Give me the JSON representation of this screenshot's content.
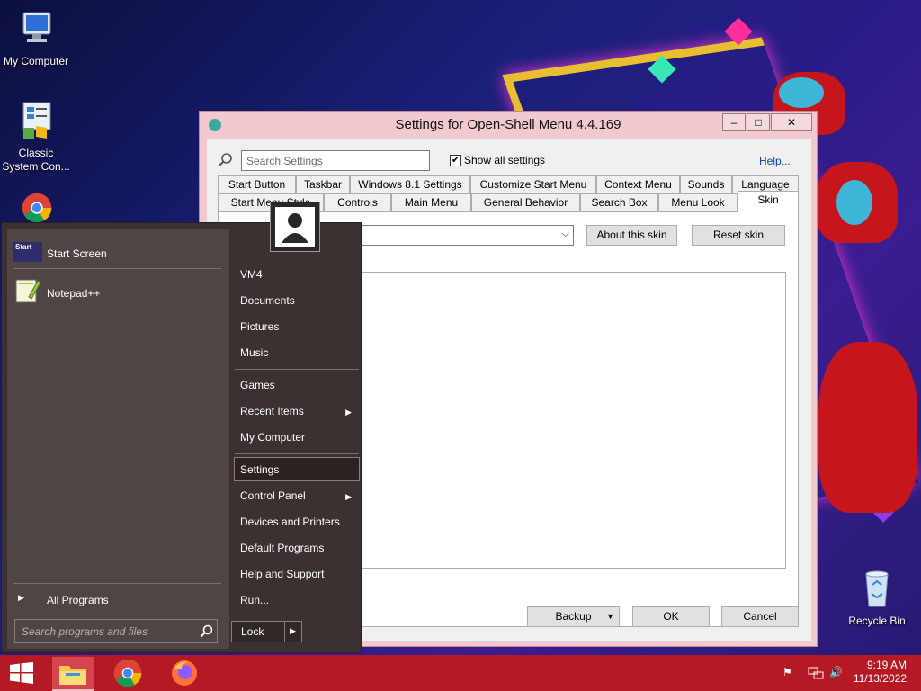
{
  "desktop": {
    "icons": [
      {
        "label": "My Computer"
      },
      {
        "label": "Classic System Con..."
      },
      {
        "label": "Recycle Bin"
      }
    ]
  },
  "settings_window": {
    "title": "Settings for Open-Shell Menu 4.4.169",
    "controls": {
      "minimize": "–",
      "maximize": "□",
      "close": "✕"
    },
    "search_placeholder": "Search Settings",
    "show_all_label": "Show all settings",
    "show_all_checked": "✔",
    "help_label": "Help...",
    "tabs_row1": [
      "Start Button",
      "Taskbar",
      "Windows 8.1 Settings",
      "Customize Start Menu",
      "Context Menu",
      "Sounds",
      "Language"
    ],
    "tabs_row2": [
      "Start Menu Style",
      "Controls",
      "Main Menu",
      "General Behavior",
      "Search Box",
      "Menu Look",
      "Skin"
    ],
    "active_tab": "Skin",
    "combo_arrow": "⌵",
    "about_skin_label": "About this skin",
    "reset_skin_label": "Reset skin",
    "backup_label": "Backup",
    "backup_arrow": "▼",
    "ok_label": "OK",
    "cancel_label": "Cancel"
  },
  "start_menu": {
    "pinned": [
      {
        "label": "Start Screen",
        "icon": "start-screen-icon",
        "icon_text": "Start"
      },
      {
        "label": "Notepad++",
        "icon": "notepad-plus-plus-icon"
      }
    ],
    "all_programs_label": "All Programs",
    "all_programs_arrow": "▶",
    "search_placeholder": "Search programs and files",
    "right_items": [
      {
        "label": "VM4"
      },
      {
        "label": "Documents"
      },
      {
        "label": "Pictures"
      },
      {
        "label": "Music"
      },
      {
        "label": "Games"
      },
      {
        "label": "Recent Items",
        "arrow": "▶"
      },
      {
        "label": "My Computer"
      },
      {
        "label": "Settings"
      },
      {
        "label": "Control Panel",
        "arrow": "▶"
      },
      {
        "label": "Devices and Printers"
      },
      {
        "label": "Default Programs"
      },
      {
        "label": "Help and Support"
      },
      {
        "label": "Run..."
      }
    ],
    "lock_label": "Lock",
    "lock_arrow": "▶"
  },
  "taskbar": {
    "time": "9:19 AM",
    "date": "11/13/2022",
    "tray_flag": "⚑",
    "tray_volume": "🔊"
  },
  "colors": {
    "taskbar": "#b51a24",
    "start_menu_bg": "#3a3130",
    "window_frame": "#f1c9cf"
  }
}
